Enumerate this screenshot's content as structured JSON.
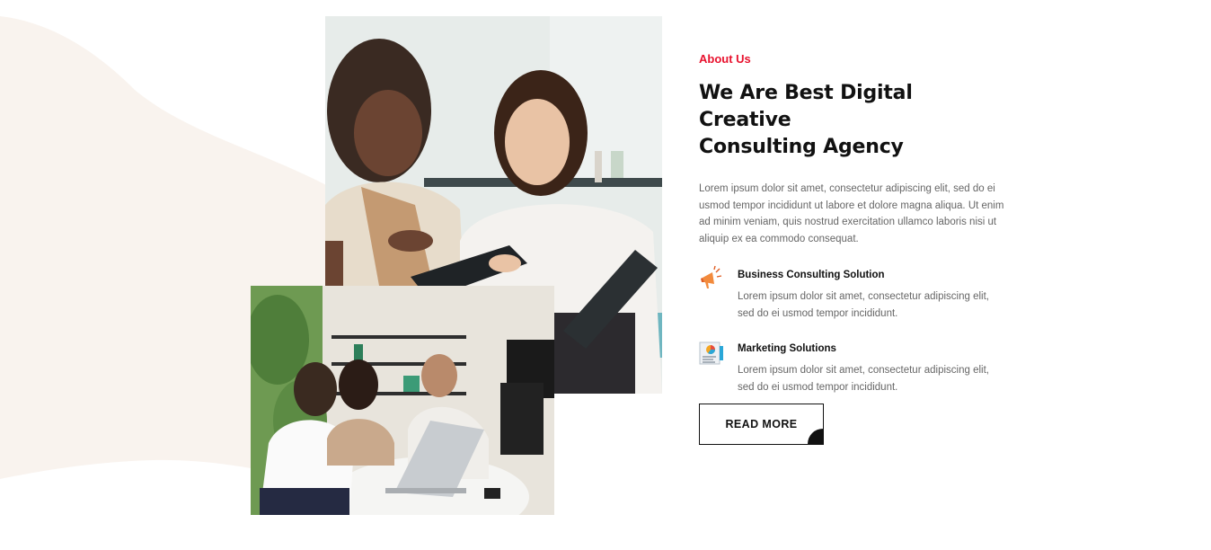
{
  "about": {
    "eyebrow": "About Us",
    "heading_line1": "We Are Best Digital Creative",
    "heading_line2": "Consulting Agency",
    "intro": "Lorem ipsum dolor sit amet, consectetur adipiscing elit, sed do ei usmod tempor incididunt ut labore et dolore magna aliqua. Ut enim ad minim veniam, quis nostrud exercitation ullamco laboris nisi ut aliquip ex ea commodo consequat.",
    "features": [
      {
        "icon": "megaphone-icon",
        "title": "Business Consulting Solution",
        "desc": "Lorem ipsum dolor sit amet, consectetur adipiscing elit, sed do ei usmod tempor incididunt."
      },
      {
        "icon": "report-chart-icon",
        "title": "Marketing Solutions",
        "desc": "Lorem ipsum dolor sit amet, consectetur adipiscing elit, sed do ei usmod tempor incididunt."
      }
    ],
    "cta_label": "READ MORE"
  },
  "colors": {
    "accent": "#e8112d",
    "blob": "#f9f3ee",
    "text": "#111111",
    "muted": "#666666"
  }
}
